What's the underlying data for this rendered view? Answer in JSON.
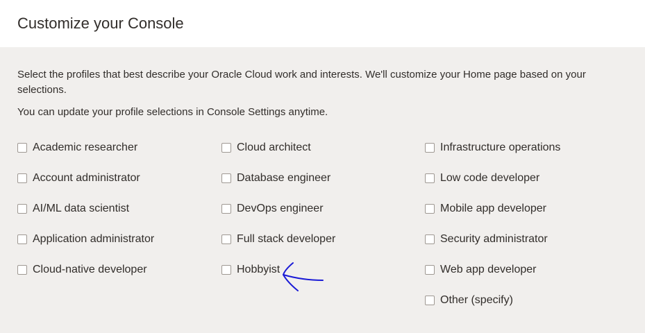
{
  "header": {
    "title": "Customize your Console"
  },
  "intro": {
    "description": "Select the profiles that best describe your Oracle Cloud work and interests. We'll customize your Home page based on your selections.",
    "update_note": "You can update your profile selections in Console Settings anytime."
  },
  "profiles": {
    "col1": [
      {
        "label": "Academic researcher",
        "checked": false
      },
      {
        "label": "Account administrator",
        "checked": false
      },
      {
        "label": "AI/ML data scientist",
        "checked": false
      },
      {
        "label": "Application administrator",
        "checked": false
      },
      {
        "label": "Cloud-native developer",
        "checked": false
      }
    ],
    "col2": [
      {
        "label": "Cloud architect",
        "checked": false
      },
      {
        "label": "Database engineer",
        "checked": false
      },
      {
        "label": "DevOps engineer",
        "checked": false
      },
      {
        "label": "Full stack developer",
        "checked": false
      },
      {
        "label": "Hobbyist",
        "checked": false
      }
    ],
    "col3": [
      {
        "label": "Infrastructure operations",
        "checked": false
      },
      {
        "label": "Low code developer",
        "checked": false
      },
      {
        "label": "Mobile app developer",
        "checked": false
      },
      {
        "label": "Security administrator",
        "checked": false
      },
      {
        "label": "Web app developer",
        "checked": false
      },
      {
        "label": "Other (specify)",
        "checked": false
      }
    ]
  },
  "annotation": {
    "icon": "hand-drawn-arrow-icon",
    "color": "#1a1ad6"
  }
}
